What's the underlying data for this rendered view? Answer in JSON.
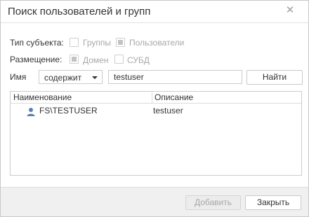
{
  "dialog": {
    "title": "Поиск пользователей и групп",
    "close_icon": "close-icon"
  },
  "subject_type": {
    "label": "Тип субъекта:",
    "options": [
      {
        "label": "Группы",
        "checked": false
      },
      {
        "label": "Пользователи",
        "checked": true
      }
    ]
  },
  "placement": {
    "label": "Размещение:",
    "options": [
      {
        "label": "Домен",
        "checked": true
      },
      {
        "label": "СУБД",
        "checked": false
      }
    ]
  },
  "name_filter": {
    "label": "Имя",
    "condition": "содержит",
    "value": "testuser",
    "find_label": "Найти"
  },
  "results": {
    "columns": [
      "Наименование",
      "Описание"
    ],
    "rows": [
      {
        "icon": "user-icon",
        "name": "FS\\TESTUSER",
        "description": "testuser"
      }
    ]
  },
  "footer": {
    "add_label": "Добавить",
    "close_label": "Закрыть"
  },
  "colors": {
    "user_icon": "#5a7fb5",
    "disabled_text": "#a8a8a8",
    "footer_bg": "#f0f0f0"
  }
}
